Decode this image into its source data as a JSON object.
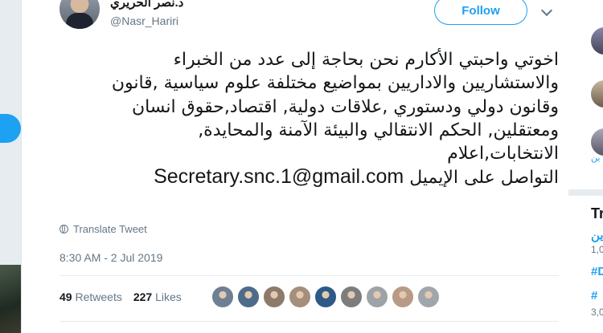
{
  "tweet": {
    "display_name": "د.نصر الحريري",
    "handle": "@Nasr_Hariri",
    "follow_label": "Follow",
    "text_lines": [
      "اخوتي واحبتي الأكارم نحن بحاجة إلى عدد من الخبراء",
      "والاستشاريين والاداريين بمواضيع مختلفة علوم سياسية ,قانون",
      "وقانون دولي ودستوري ,علاقات دولية, اقتصاد,حقوق انسان",
      "ومعتقلين, الحكم الانتقالي والبيئة الآمنة والمحايدة,",
      "الانتخابات,اعلام"
    ],
    "contact_prefix": "التواصل على الإيميل",
    "email": "Secretary.snc.1@gmail.com",
    "translate_label": "Translate Tweet",
    "timestamp": "8:30 AM - 2 Jul 2019",
    "retweets_count": "49",
    "retweets_label": "Retweets",
    "likes_count": "227",
    "likes_label": "Likes",
    "liker_colors": [
      "#6f7f94",
      "#4d6b8a",
      "#8d7a6a",
      "#a58e7b",
      "#2d5a87",
      "#7d7d7d",
      "#9ea3a8",
      "#b89a86",
      "#a0a6ac"
    ]
  },
  "right_panel": {
    "heading": "Tr",
    "line1": "ين",
    "line2": "1,0",
    "hashtag1": "#D",
    "hashtag2": "#",
    "line3": "3,0"
  }
}
